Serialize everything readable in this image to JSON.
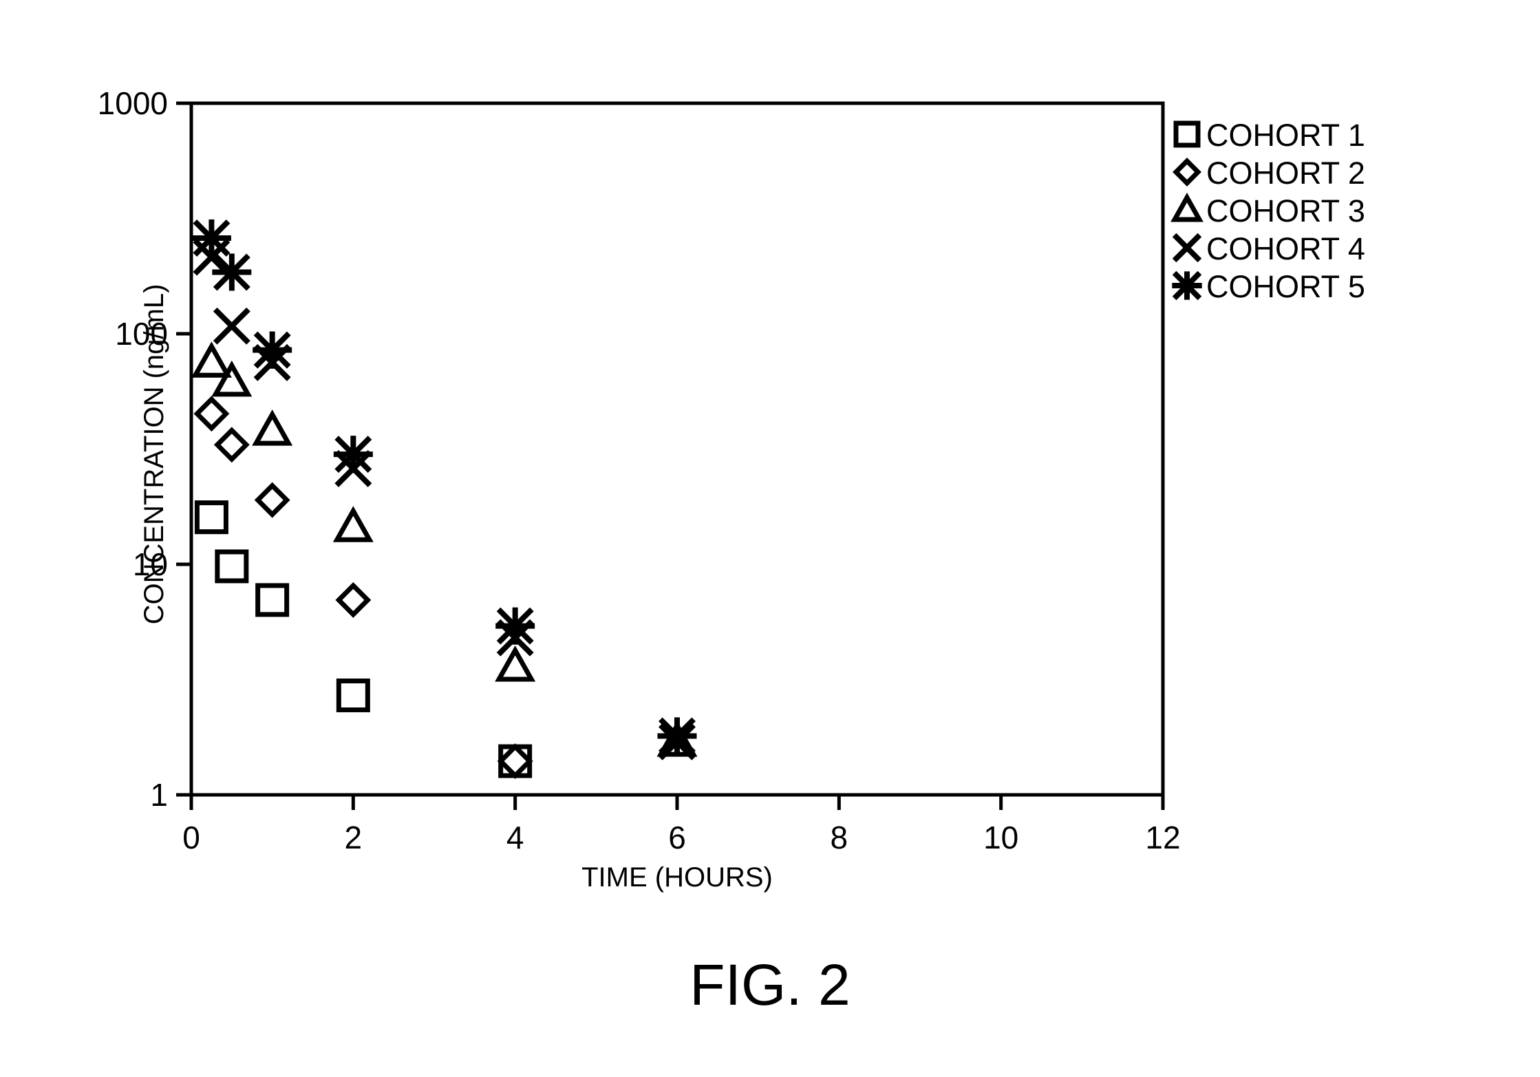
{
  "figure": {
    "caption": "FIG. 2"
  },
  "chart_data": {
    "type": "scatter",
    "title": "",
    "xlabel": "TIME (HOURS)",
    "ylabel": "CONCENTRATION (ng/mL)",
    "xlim": [
      0,
      12
    ],
    "ylim": [
      1,
      1000
    ],
    "yscale": "log",
    "xscale": "linear",
    "grid": false,
    "legend_position": "top-right",
    "xticks": [
      0,
      2,
      4,
      6,
      8,
      10,
      12
    ],
    "xtick_labels": [
      "0",
      "2",
      "4",
      "6",
      "8",
      "10",
      "12"
    ],
    "yticks": [
      1,
      10,
      100,
      1000
    ],
    "ytick_labels": [
      "1",
      "10",
      "100",
      "1000"
    ],
    "series": [
      {
        "name": "COHORT 1",
        "marker": "square",
        "x": [
          0.25,
          0.5,
          1,
          2,
          4
        ],
        "y": [
          16,
          9.8,
          7,
          2.7,
          1.4
        ]
      },
      {
        "name": "COHORT 2",
        "marker": "diamond",
        "x": [
          0.25,
          0.5,
          1,
          2,
          4
        ],
        "y": [
          45,
          33,
          19,
          7,
          1.4
        ]
      },
      {
        "name": "COHORT 3",
        "marker": "triangle",
        "x": [
          0.25,
          0.5,
          1,
          2,
          4,
          6
        ],
        "y": [
          75,
          62,
          38,
          14.5,
          3.6,
          1.7
        ]
      },
      {
        "name": "COHORT 4",
        "marker": "x",
        "x": [
          0.25,
          0.5,
          1,
          2,
          4,
          6
        ],
        "y": [
          215,
          108,
          75,
          26,
          4.8,
          1.7
        ]
      },
      {
        "name": "COHORT 5",
        "marker": "asterisk",
        "x": [
          0.25,
          0.5,
          1,
          2,
          4,
          6
        ],
        "y": [
          260,
          185,
          85,
          30,
          5.4,
          1.8
        ]
      }
    ]
  },
  "legend": {
    "entries": [
      {
        "label": "COHORT 1",
        "marker": "square"
      },
      {
        "label": "COHORT 2",
        "marker": "diamond"
      },
      {
        "label": "COHORT 3",
        "marker": "triangle"
      },
      {
        "label": "COHORT 4",
        "marker": "x"
      },
      {
        "label": "COHORT 5",
        "marker": "asterisk"
      }
    ]
  }
}
